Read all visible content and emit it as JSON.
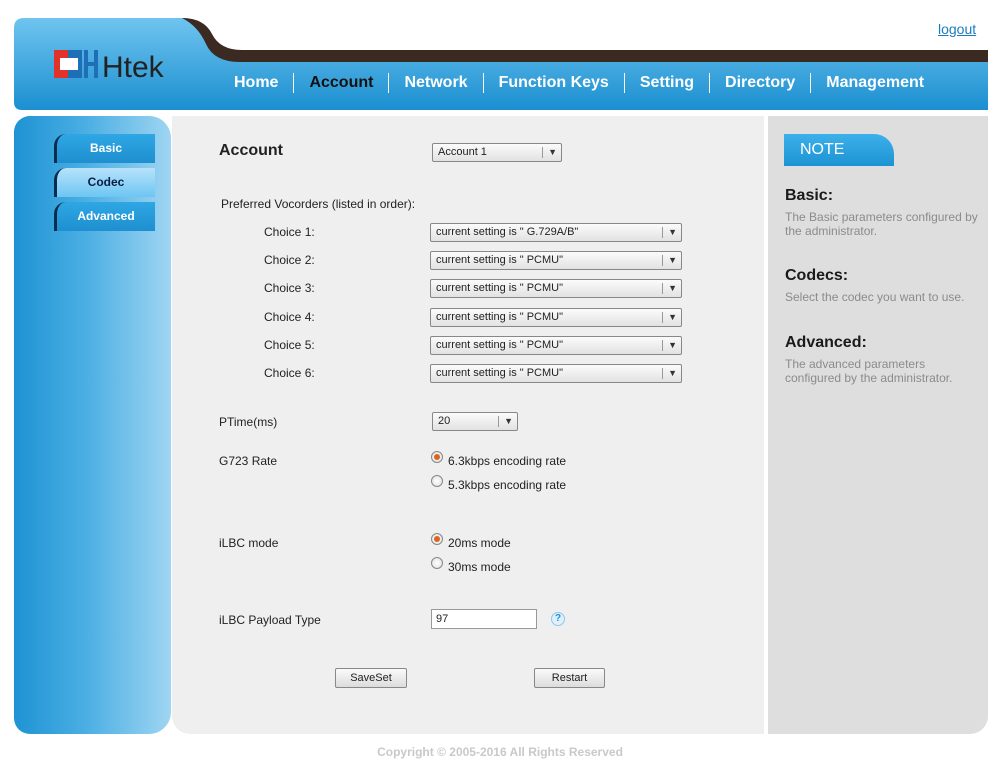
{
  "header": {
    "logo_text": "Htek",
    "logout": "logout",
    "nav": [
      "Home",
      "Account",
      "Network",
      "Function Keys",
      "Setting",
      "Directory",
      "Management"
    ],
    "nav_active": "Account"
  },
  "sidebar": {
    "items": [
      "Basic",
      "Codec",
      "Advanced"
    ],
    "active": "Codec"
  },
  "main": {
    "account_label": "Account",
    "account_value": "Account 1",
    "vocoders_label": "Preferred Vocorders (listed in order):",
    "choices": [
      {
        "label": "Choice 1:",
        "value": "current setting is \" G.729A/B\""
      },
      {
        "label": "Choice 2:",
        "value": "current setting is \" PCMU\""
      },
      {
        "label": "Choice 3:",
        "value": "current setting is \" PCMU\""
      },
      {
        "label": "Choice 4:",
        "value": "current setting is \" PCMU\""
      },
      {
        "label": "Choice 5:",
        "value": "current setting is \" PCMU\""
      },
      {
        "label": "Choice 6:",
        "value": "current setting is \" PCMU\""
      }
    ],
    "ptime_label": "PTime(ms)",
    "ptime_value": "20",
    "g723_label": "G723 Rate",
    "g723_options": [
      "6.3kbps encoding rate",
      "5.3kbps encoding rate"
    ],
    "g723_selected": 0,
    "ilbc_label": "iLBC mode",
    "ilbc_options": [
      "20ms mode",
      "30ms mode"
    ],
    "ilbc_selected": 0,
    "payload_label": "iLBC Payload Type",
    "payload_value": "97",
    "save_label": "SaveSet",
    "restart_label": "Restart"
  },
  "note": {
    "title": "NOTE",
    "sections": [
      {
        "heading": "Basic:",
        "text": "The Basic parameters configured by the administrator."
      },
      {
        "heading": "Codecs:",
        "text": "Select the codec you want to use."
      },
      {
        "heading": "Advanced:",
        "text": "The advanced parameters configured by the administrator."
      }
    ]
  },
  "footer": {
    "copyright": "Copyright © 2005-2016 All Rights Reserved"
  },
  "colors": {
    "brand_blue": "#1e93d3",
    "dark_arc": "#3a2a22",
    "radio_dot": "#d9661e",
    "logo_red": "#e2332b"
  }
}
